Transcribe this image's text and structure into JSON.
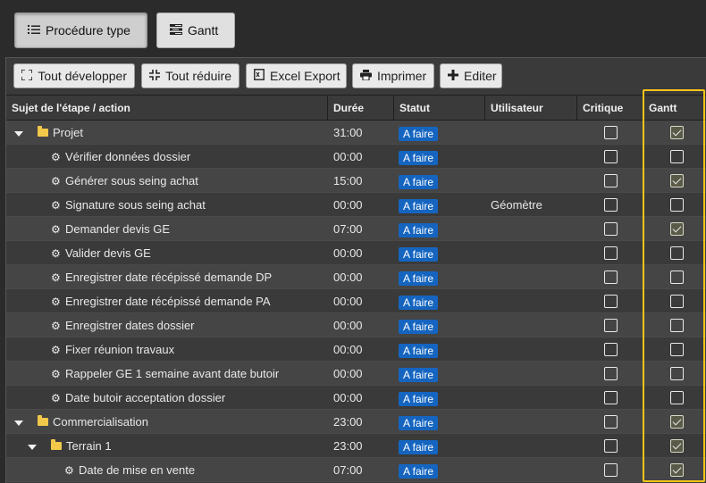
{
  "top_tabs": {
    "procedure_label": "Procédure type",
    "gantt_label": "Gantt"
  },
  "toolbar": {
    "expand_label": "Tout développer",
    "collapse_label": "Tout réduire",
    "excel_label": "Excel Export",
    "print_label": "Imprimer",
    "edit_label": "Editer"
  },
  "columns": {
    "subject": "Sujet de l'étape / action",
    "duration": "Durée",
    "status": "Statut",
    "user": "Utilisateur",
    "critical": "Critique",
    "gantt": "Gantt"
  },
  "rows": [
    {
      "label": "Projet",
      "type": "folder",
      "level": 0,
      "expanded": true,
      "duration": "31:00",
      "status": "A faire",
      "user": "",
      "critical": false,
      "gantt": true
    },
    {
      "label": "Vérifier données dossier",
      "type": "action",
      "level": 1,
      "duration": "00:00",
      "status": "A faire",
      "user": "",
      "critical": false,
      "gantt": false
    },
    {
      "label": "Générer sous seing achat",
      "type": "action",
      "level": 1,
      "duration": "15:00",
      "status": "A faire",
      "user": "",
      "critical": false,
      "gantt": true
    },
    {
      "label": "Signature sous seing achat",
      "type": "action",
      "level": 1,
      "duration": "00:00",
      "status": "A faire",
      "user": "Géomètre",
      "critical": false,
      "gantt": false
    },
    {
      "label": "Demander devis GE",
      "type": "action",
      "level": 1,
      "duration": "07:00",
      "status": "A faire",
      "user": "",
      "critical": false,
      "gantt": true
    },
    {
      "label": "Valider devis GE",
      "type": "action",
      "level": 1,
      "duration": "00:00",
      "status": "A faire",
      "user": "",
      "critical": false,
      "gantt": false
    },
    {
      "label": "Enregistrer date récépissé demande DP",
      "type": "action",
      "level": 1,
      "duration": "00:00",
      "status": "A faire",
      "user": "",
      "critical": false,
      "gantt": false
    },
    {
      "label": "Enregistrer date récépissé demande PA",
      "type": "action",
      "level": 1,
      "duration": "00:00",
      "status": "A faire",
      "user": "",
      "critical": false,
      "gantt": false
    },
    {
      "label": "Enregistrer dates dossier",
      "type": "action",
      "level": 1,
      "duration": "00:00",
      "status": "A faire",
      "user": "",
      "critical": false,
      "gantt": false
    },
    {
      "label": "Fixer réunion travaux",
      "type": "action",
      "level": 1,
      "duration": "00:00",
      "status": "A faire",
      "user": "",
      "critical": false,
      "gantt": false
    },
    {
      "label": "Rappeler GE 1 semaine avant date butoir",
      "type": "action",
      "level": 1,
      "duration": "00:00",
      "status": "A faire",
      "user": "",
      "critical": false,
      "gantt": false
    },
    {
      "label": "Date butoir acceptation dossier",
      "type": "action",
      "level": 1,
      "duration": "00:00",
      "status": "A faire",
      "user": "",
      "critical": false,
      "gantt": false
    },
    {
      "label": "Commercialisation",
      "type": "folder",
      "level": 0,
      "expanded": true,
      "duration": "23:00",
      "status": "A faire",
      "user": "",
      "critical": false,
      "gantt": true
    },
    {
      "label": "Terrain 1",
      "type": "folder",
      "level": 1,
      "expanded": true,
      "duration": "23:00",
      "status": "A faire",
      "user": "",
      "critical": false,
      "gantt": true
    },
    {
      "label": "Date de mise en vente",
      "type": "action",
      "level": 2,
      "duration": "07:00",
      "status": "A faire",
      "user": "",
      "critical": false,
      "gantt": true
    }
  ],
  "colors": {
    "badge": "#1565c0",
    "highlight": "#f5c518",
    "folder": "#f2c84b"
  },
  "icons": {
    "procedure": "list-check-icon",
    "gantt": "gantt-bars-icon",
    "expand": "expand-icon",
    "collapse": "compress-icon",
    "excel": "spreadsheet-icon",
    "print": "printer-icon",
    "edit": "plus-icon",
    "folder": "folder-icon",
    "action": "gears-icon",
    "caret": "caret-down-icon"
  }
}
